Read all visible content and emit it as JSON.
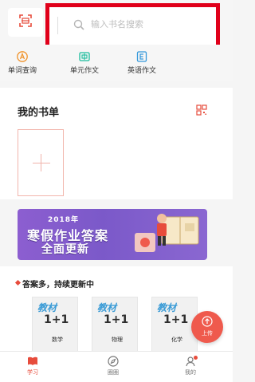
{
  "colors": {
    "accent": "#e74c3c",
    "highlight_red": "#e0001a",
    "banner_purple": "#8560cf",
    "upload_red": "#ef5a4d"
  },
  "header": {
    "scan_icon": "scan-icon",
    "search": {
      "placeholder": "输入书名搜索",
      "icon": "search-icon"
    }
  },
  "quick_menu": [
    {
      "label": "单词查询",
      "icon": "letter-a-icon"
    },
    {
      "label": "单元作文",
      "icon": "chinese-zhong-icon"
    },
    {
      "label": "英语作文",
      "icon": "english-e-icon"
    }
  ],
  "my_books": {
    "title": "我的书单",
    "qr_icon": "qr-code-icon"
  },
  "banner": {
    "year": "2018年",
    "line1": "寒假作业答案",
    "line2": "全面更新"
  },
  "recommend": {
    "title": "答案多，持续更新中",
    "books": [
      {
        "brand": "教材",
        "series": "1+1",
        "subject": "数学"
      },
      {
        "brand": "教材",
        "series": "1+1",
        "subject": "物理"
      },
      {
        "brand": "教材",
        "series": "1+1",
        "subject": "化学"
      }
    ]
  },
  "upload": {
    "label": "上传"
  },
  "nav": [
    {
      "label": "学习",
      "icon": "book-icon"
    },
    {
      "label": "圈圈",
      "icon": "compass-icon"
    },
    {
      "label": "我的",
      "icon": "user-icon"
    }
  ]
}
